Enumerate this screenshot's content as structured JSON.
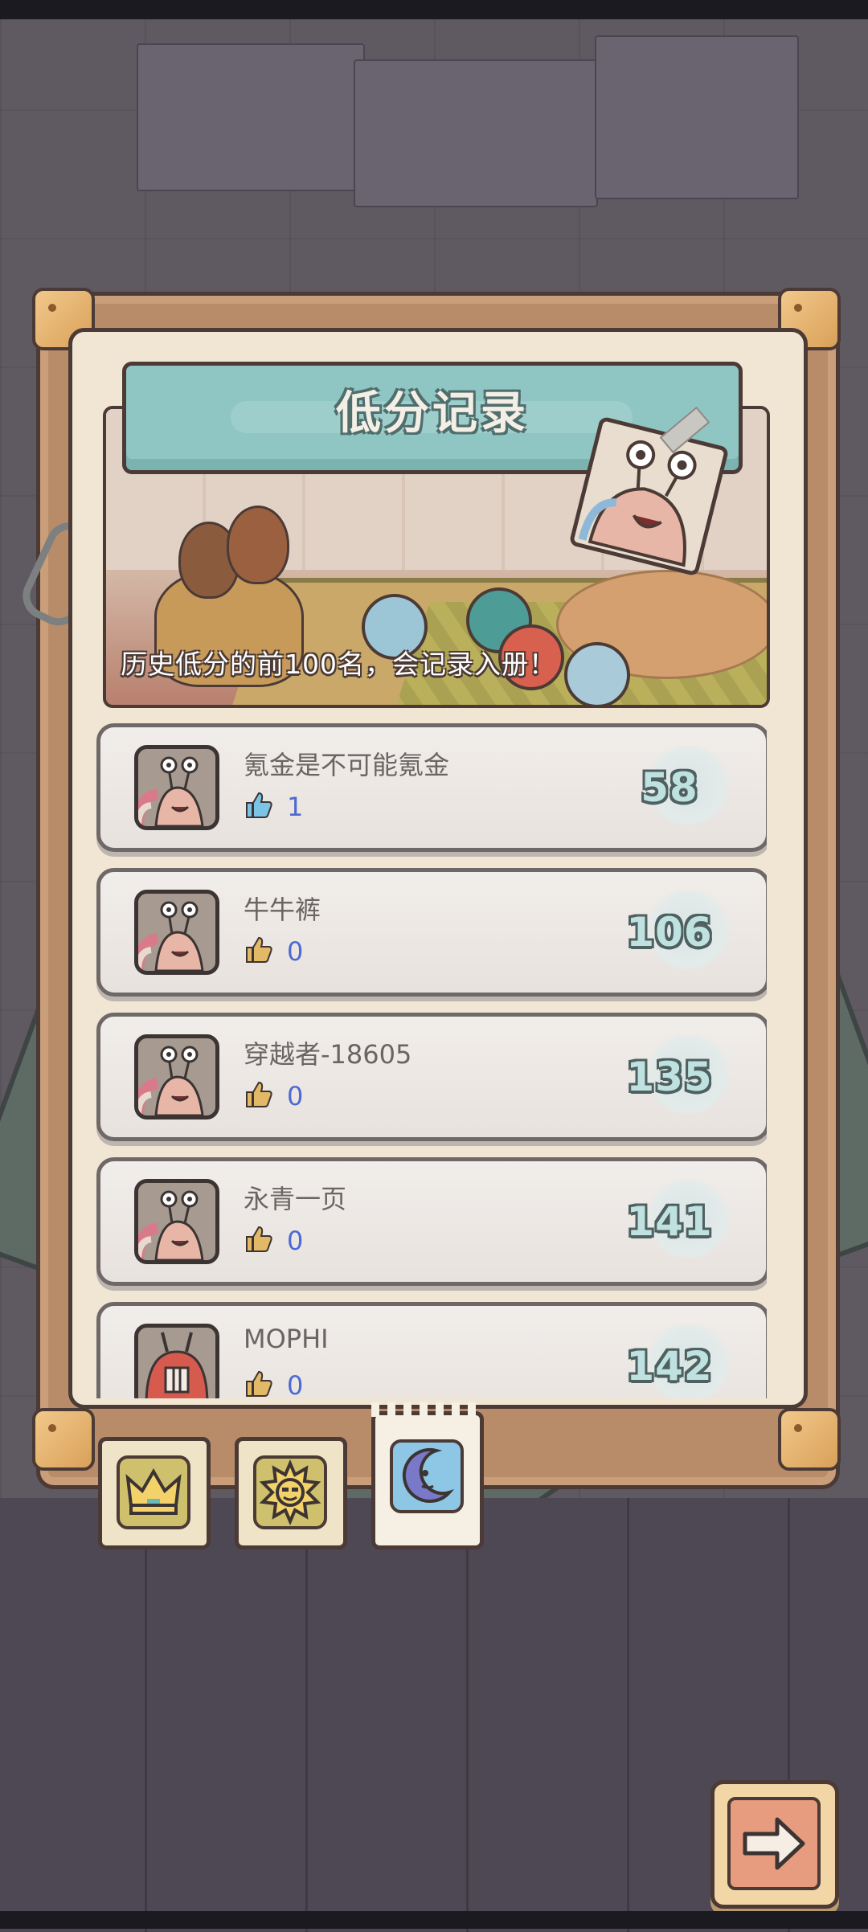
{
  "title": "低分记录",
  "caption": "历史低分的前100名，会记录入册！",
  "leaderboard": [
    {
      "name": "氪金是不可能氪金",
      "likes": "1",
      "score": "58",
      "liked": true
    },
    {
      "name": "牛牛裤",
      "likes": "0",
      "score": "106",
      "liked": false
    },
    {
      "name": "穿越者-18605",
      "likes": "0",
      "score": "135",
      "liked": false
    },
    {
      "name": "永青一页",
      "likes": "0",
      "score": "141",
      "liked": false
    },
    {
      "name": "MOPHI",
      "likes": "0",
      "score": "142",
      "liked": false
    }
  ],
  "tabs": [
    {
      "icon": "crown-icon",
      "active": false
    },
    {
      "icon": "sun-icon",
      "active": false
    },
    {
      "icon": "moon-icon",
      "active": true
    }
  ],
  "colors": {
    "frame": "#b88c68",
    "panel": "#f1e6d3",
    "title_banner": "#8fc6c3",
    "score_fill": "#bfe2e0",
    "like_active": "#7cc4e6",
    "like_inactive": "#e3b866",
    "like_count": "#4e6ad0"
  }
}
